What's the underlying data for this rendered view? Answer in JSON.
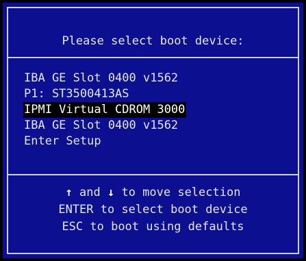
{
  "screen": {
    "title": "Please select boot device:",
    "boot_devices": [
      {
        "label": "IBA GE Slot 0400 v1562",
        "selected": false
      },
      {
        "label": "P1: ST3500413AS",
        "selected": false
      },
      {
        "label": "IPMI Virtual CDROM 3000",
        "selected": true
      },
      {
        "label": "IBA GE Slot 0400 v1562",
        "selected": false
      },
      {
        "label": "Enter Setup",
        "selected": false
      }
    ],
    "help": {
      "up_arrow": "↑",
      "and_text": " and ",
      "down_arrow": "↓",
      "move_text": " to move selection",
      "enter_line": "ENTER to select boot device",
      "esc_line": "ESC to boot using defaults"
    }
  },
  "colors": {
    "background": "#0b0f90",
    "outer": "#000000",
    "border": "#cfd2e6",
    "text": "#e6e6e6",
    "highlight_bg": "#000000",
    "highlight_text": "#ffffff"
  },
  "icons": {
    "up": "up-arrow-icon",
    "down": "down-arrow-icon"
  }
}
